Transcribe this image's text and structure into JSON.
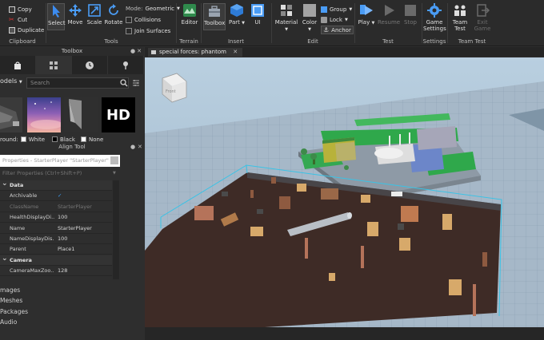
{
  "ribbon": {
    "clipboard": {
      "copy": "Copy",
      "cut": "Cut",
      "duplicate": "Duplicate",
      "label": "Clipboard"
    },
    "tools": {
      "select": "Select",
      "move": "Move",
      "scale": "Scale",
      "rotate": "Rotate",
      "mode_label": "Mode:",
      "mode_value": "Geometric",
      "collisions": "Collisions",
      "join_surfaces": "Join Surfaces",
      "label": "Tools"
    },
    "terrain": {
      "editor": "Editor",
      "label": "Terrain"
    },
    "insert": {
      "toolbox": "Toolbox",
      "part": "Part",
      "ui": "UI",
      "label": "Insert"
    },
    "edit": {
      "material": "Material",
      "color": "Color",
      "group": "Group",
      "lock": "Lock",
      "anchor": "Anchor",
      "label": "Edit"
    },
    "test": {
      "play": "Play",
      "resume": "Resume",
      "stop": "Stop",
      "label": "Test"
    },
    "settings": {
      "game_settings_1": "Game",
      "game_settings_2": "Settings",
      "label": "Settings"
    },
    "team_test": {
      "team_1": "Team",
      "team_2": "Test",
      "exit_1": "Exit",
      "exit_2": "Game",
      "label": "Team Test"
    }
  },
  "toolbox": {
    "header": "Toolbox",
    "category": "odels",
    "search_placeholder": "Search",
    "hd_label": "HD",
    "background_label": "round:",
    "bg_white": "White",
    "bg_black": "Black",
    "bg_none": "None"
  },
  "align_tool": {
    "header": "Align Tool"
  },
  "properties": {
    "search_placeholder": "Properties - StarterPlayer \"StarterPlayer\"",
    "filter_placeholder": "Filter Properties (Ctrl+Shift+P)",
    "rows": [
      {
        "key": "Data",
        "value": "",
        "type": "cat"
      },
      {
        "key": "Archivable",
        "value": "✓",
        "type": "row"
      },
      {
        "key": "ClassName",
        "value": "StarterPlayer",
        "type": "dim"
      },
      {
        "key": "HealthDisplayDi...",
        "value": "100",
        "type": "row"
      },
      {
        "key": "Name",
        "value": "StarterPlayer",
        "type": "row"
      },
      {
        "key": "NameDisplayDis...",
        "value": "100",
        "type": "row"
      },
      {
        "key": "Parent",
        "value": "Place1",
        "type": "row"
      },
      {
        "key": "Camera",
        "value": "",
        "type": "cat"
      },
      {
        "key": "CameraMaxZoo...",
        "value": "128",
        "type": "row"
      }
    ]
  },
  "left_list": [
    "mages",
    "Meshes",
    "Packages",
    "Audio"
  ],
  "viewport": {
    "tab_title": "special forces: phantom",
    "view_cube_label": "Front"
  }
}
